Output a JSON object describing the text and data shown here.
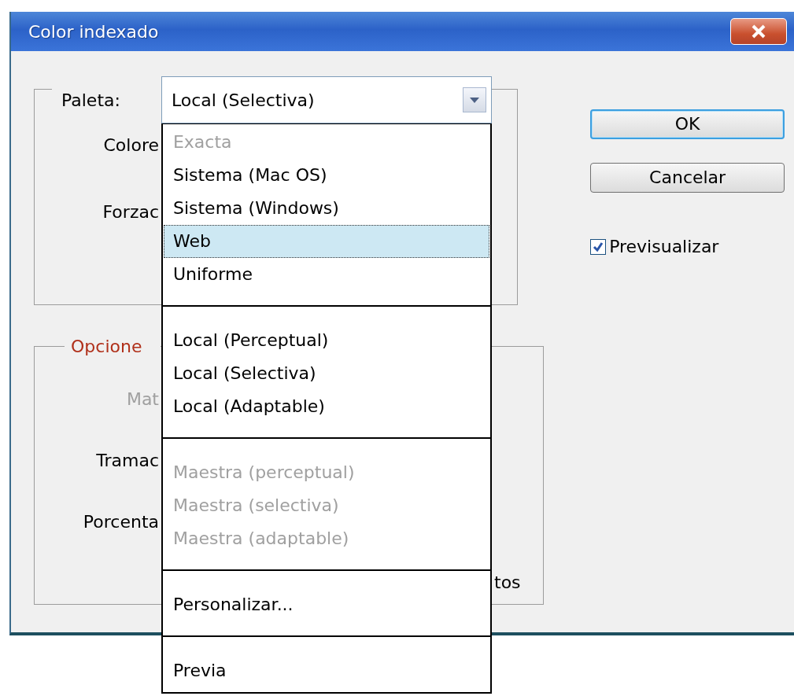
{
  "window": {
    "title": "Color indexado"
  },
  "palette": {
    "label": "Paleta:",
    "value": "Local (Selectiva)"
  },
  "palette_labels": [
    {
      "text": "Colore",
      "disabled": false
    },
    {
      "text": "Forzac",
      "disabled": false
    }
  ],
  "options": {
    "legend": "Opcione",
    "labels": [
      {
        "text": "Mat",
        "disabled": true
      },
      {
        "text": "Tramac",
        "disabled": false
      },
      {
        "text": "Porcenta",
        "disabled": false
      }
    ],
    "trailing_text": "tos"
  },
  "buttons": [
    {
      "label": "OK",
      "focused": true
    },
    {
      "label": "Cancelar",
      "focused": false
    }
  ],
  "preview": {
    "label": "Previsualizar",
    "checked": true
  },
  "dropdown": {
    "groups": [
      {
        "items": [
          {
            "label": "Exacta",
            "disabled": true,
            "selected": false
          },
          {
            "label": "Sistema (Mac OS)",
            "disabled": false,
            "selected": false
          },
          {
            "label": "Sistema (Windows)",
            "disabled": false,
            "selected": false
          },
          {
            "label": "Web",
            "disabled": false,
            "selected": true
          },
          {
            "label": "Uniforme",
            "disabled": false,
            "selected": false
          }
        ]
      },
      {
        "items": [
          {
            "label": "Local (Perceptual)",
            "disabled": false,
            "selected": false
          },
          {
            "label": "Local (Selectiva)",
            "disabled": false,
            "selected": false
          },
          {
            "label": "Local (Adaptable)",
            "disabled": false,
            "selected": false
          }
        ]
      },
      {
        "items": [
          {
            "label": "Maestra (perceptual)",
            "disabled": true,
            "selected": false
          },
          {
            "label": "Maestra (selectiva)",
            "disabled": true,
            "selected": false
          },
          {
            "label": "Maestra (adaptable)",
            "disabled": true,
            "selected": false
          }
        ]
      },
      {
        "items": [
          {
            "label": "Personalizar...",
            "disabled": false,
            "selected": false
          }
        ]
      },
      {
        "items": [
          {
            "label": "Previa",
            "disabled": false,
            "selected": false
          }
        ]
      }
    ]
  }
}
